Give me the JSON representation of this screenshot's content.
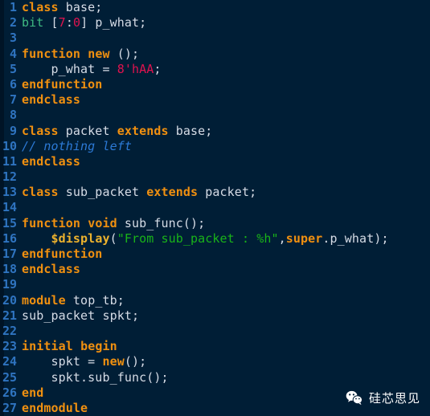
{
  "editor": {
    "language": "SystemVerilog",
    "background_color": "#001e36",
    "gutter_color": "#001426",
    "line_number_color": "#2f74c0",
    "default_text_color": "#d6dce6",
    "keyword_color": "#f09010",
    "type_color": "#3fba82",
    "number_color": "#e0134f",
    "string_color": "#19b319",
    "comment_color": "#2c7ad6",
    "system_task_color": "#ecb22e",
    "line_count": 27,
    "lines": [
      {
        "n": "1",
        "tokens": [
          {
            "t": "class",
            "c": "kw"
          },
          {
            "t": " base;",
            "c": "id"
          }
        ]
      },
      {
        "n": "2",
        "tokens": [
          {
            "t": "bit",
            "c": "type"
          },
          {
            "t": " [",
            "c": "id"
          },
          {
            "t": "7",
            "c": "num"
          },
          {
            "t": ":",
            "c": "id"
          },
          {
            "t": "0",
            "c": "num"
          },
          {
            "t": "] p_what;",
            "c": "id"
          }
        ]
      },
      {
        "n": "3",
        "tokens": []
      },
      {
        "n": "4",
        "tokens": [
          {
            "t": "function",
            "c": "kw"
          },
          {
            "t": " ",
            "c": "id"
          },
          {
            "t": "new",
            "c": "kw"
          },
          {
            "t": " ();",
            "c": "id"
          }
        ]
      },
      {
        "n": "5",
        "tokens": [
          {
            "t": "    p_what = ",
            "c": "id"
          },
          {
            "t": "8'hAA",
            "c": "num"
          },
          {
            "t": ";",
            "c": "id"
          }
        ]
      },
      {
        "n": "6",
        "tokens": [
          {
            "t": "endfunction",
            "c": "kw"
          }
        ]
      },
      {
        "n": "7",
        "tokens": [
          {
            "t": "endclass",
            "c": "kw"
          }
        ]
      },
      {
        "n": "8",
        "tokens": []
      },
      {
        "n": "9",
        "tokens": [
          {
            "t": "class",
            "c": "kw"
          },
          {
            "t": " packet ",
            "c": "id"
          },
          {
            "t": "extends",
            "c": "kw"
          },
          {
            "t": " base;",
            "c": "id"
          }
        ]
      },
      {
        "n": "10",
        "tokens": [
          {
            "t": "// nothing left",
            "c": "cmt"
          }
        ]
      },
      {
        "n": "11",
        "tokens": [
          {
            "t": "endclass",
            "c": "kw"
          }
        ]
      },
      {
        "n": "12",
        "tokens": []
      },
      {
        "n": "13",
        "tokens": [
          {
            "t": "class",
            "c": "kw"
          },
          {
            "t": " sub_packet ",
            "c": "id"
          },
          {
            "t": "extends",
            "c": "kw"
          },
          {
            "t": " packet;",
            "c": "id"
          }
        ]
      },
      {
        "n": "14",
        "tokens": []
      },
      {
        "n": "15",
        "tokens": [
          {
            "t": "function",
            "c": "kw"
          },
          {
            "t": " ",
            "c": "id"
          },
          {
            "t": "void",
            "c": "kw"
          },
          {
            "t": " sub_func();",
            "c": "id"
          }
        ]
      },
      {
        "n": "16",
        "tokens": [
          {
            "t": "    ",
            "c": "id"
          },
          {
            "t": "$display",
            "c": "sys"
          },
          {
            "t": "(",
            "c": "id"
          },
          {
            "t": "\"From sub_packet : %h\"",
            "c": "str"
          },
          {
            "t": ",",
            "c": "id"
          },
          {
            "t": "super",
            "c": "kw"
          },
          {
            "t": ".p_what);",
            "c": "id"
          }
        ]
      },
      {
        "n": "17",
        "tokens": [
          {
            "t": "endfunction",
            "c": "kw"
          }
        ]
      },
      {
        "n": "18",
        "tokens": [
          {
            "t": "endclass",
            "c": "kw"
          }
        ]
      },
      {
        "n": "19",
        "tokens": []
      },
      {
        "n": "20",
        "tokens": [
          {
            "t": "module",
            "c": "kw"
          },
          {
            "t": " top_tb;",
            "c": "id"
          }
        ]
      },
      {
        "n": "21",
        "tokens": [
          {
            "t": "sub_packet spkt;",
            "c": "id"
          }
        ]
      },
      {
        "n": "22",
        "tokens": []
      },
      {
        "n": "23",
        "tokens": [
          {
            "t": "initial",
            "c": "kw"
          },
          {
            "t": " ",
            "c": "id"
          },
          {
            "t": "begin",
            "c": "kw"
          }
        ]
      },
      {
        "n": "24",
        "tokens": [
          {
            "t": "    spkt = ",
            "c": "id"
          },
          {
            "t": "new",
            "c": "kw"
          },
          {
            "t": "();",
            "c": "id"
          }
        ]
      },
      {
        "n": "25",
        "tokens": [
          {
            "t": "    spkt.sub_func();",
            "c": "id"
          }
        ]
      },
      {
        "n": "26",
        "tokens": [
          {
            "t": "end",
            "c": "kw"
          }
        ]
      },
      {
        "n": "27",
        "tokens": [
          {
            "t": "endmodule",
            "c": "kw"
          }
        ]
      }
    ]
  },
  "watermark": {
    "icon": "wechat-icon",
    "text": "硅芯思见",
    "text_color": "#ffffff"
  }
}
